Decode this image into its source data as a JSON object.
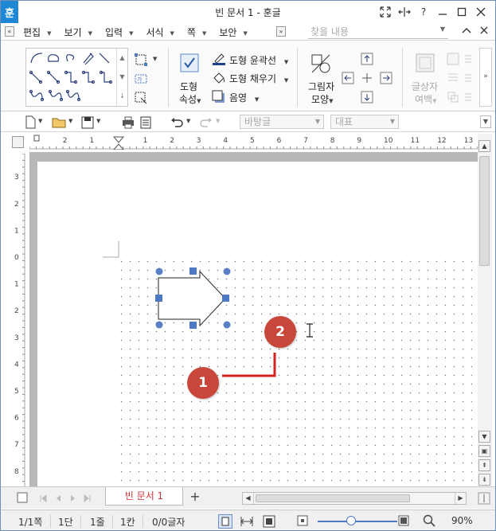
{
  "window": {
    "title": "빈 문서 1 - 훈글",
    "logo": "훈"
  },
  "menu": {
    "items": [
      "편집",
      "보기",
      "입력",
      "서식",
      "쪽",
      "보안"
    ],
    "search_placeholder": "찾을 내용"
  },
  "ribbon": {
    "shape_props_line1": "도형",
    "shape_props_line2": "속성",
    "outline": "도형 윤곽선",
    "fill": "도형 채우기",
    "shadow": "음영",
    "picture_shape_line1": "그림자",
    "picture_shape_line2": "모양",
    "text_margin_line1": "글상자",
    "text_margin_line2": "여백"
  },
  "toolbar": {
    "style_combo": "바탕글",
    "font_combo": "대표"
  },
  "ruler": {
    "h_labels": [
      "2",
      "1",
      "1",
      "2",
      "3",
      "4",
      "5",
      "6",
      "7",
      "8",
      "9",
      "10",
      "11",
      "12",
      "13"
    ],
    "v_labels": [
      "3",
      "2",
      "1",
      "0",
      "1",
      "2",
      "3",
      "4",
      "5",
      "6",
      "7",
      "8"
    ]
  },
  "tabs": {
    "doc_tab": "빈 문서 1",
    "add": "+"
  },
  "status": {
    "page": "1/1쪽",
    "section": "1단",
    "line": "1줄",
    "col": "1칸",
    "chars": "0/0글자",
    "zoom": "90%"
  },
  "annotations": {
    "badge1": "1",
    "badge2": "2"
  },
  "colors": {
    "accent": "#1e88d4",
    "handle": "#4f78c4",
    "annotation_red": "#c9473a",
    "tab_text": "#d0343a"
  }
}
